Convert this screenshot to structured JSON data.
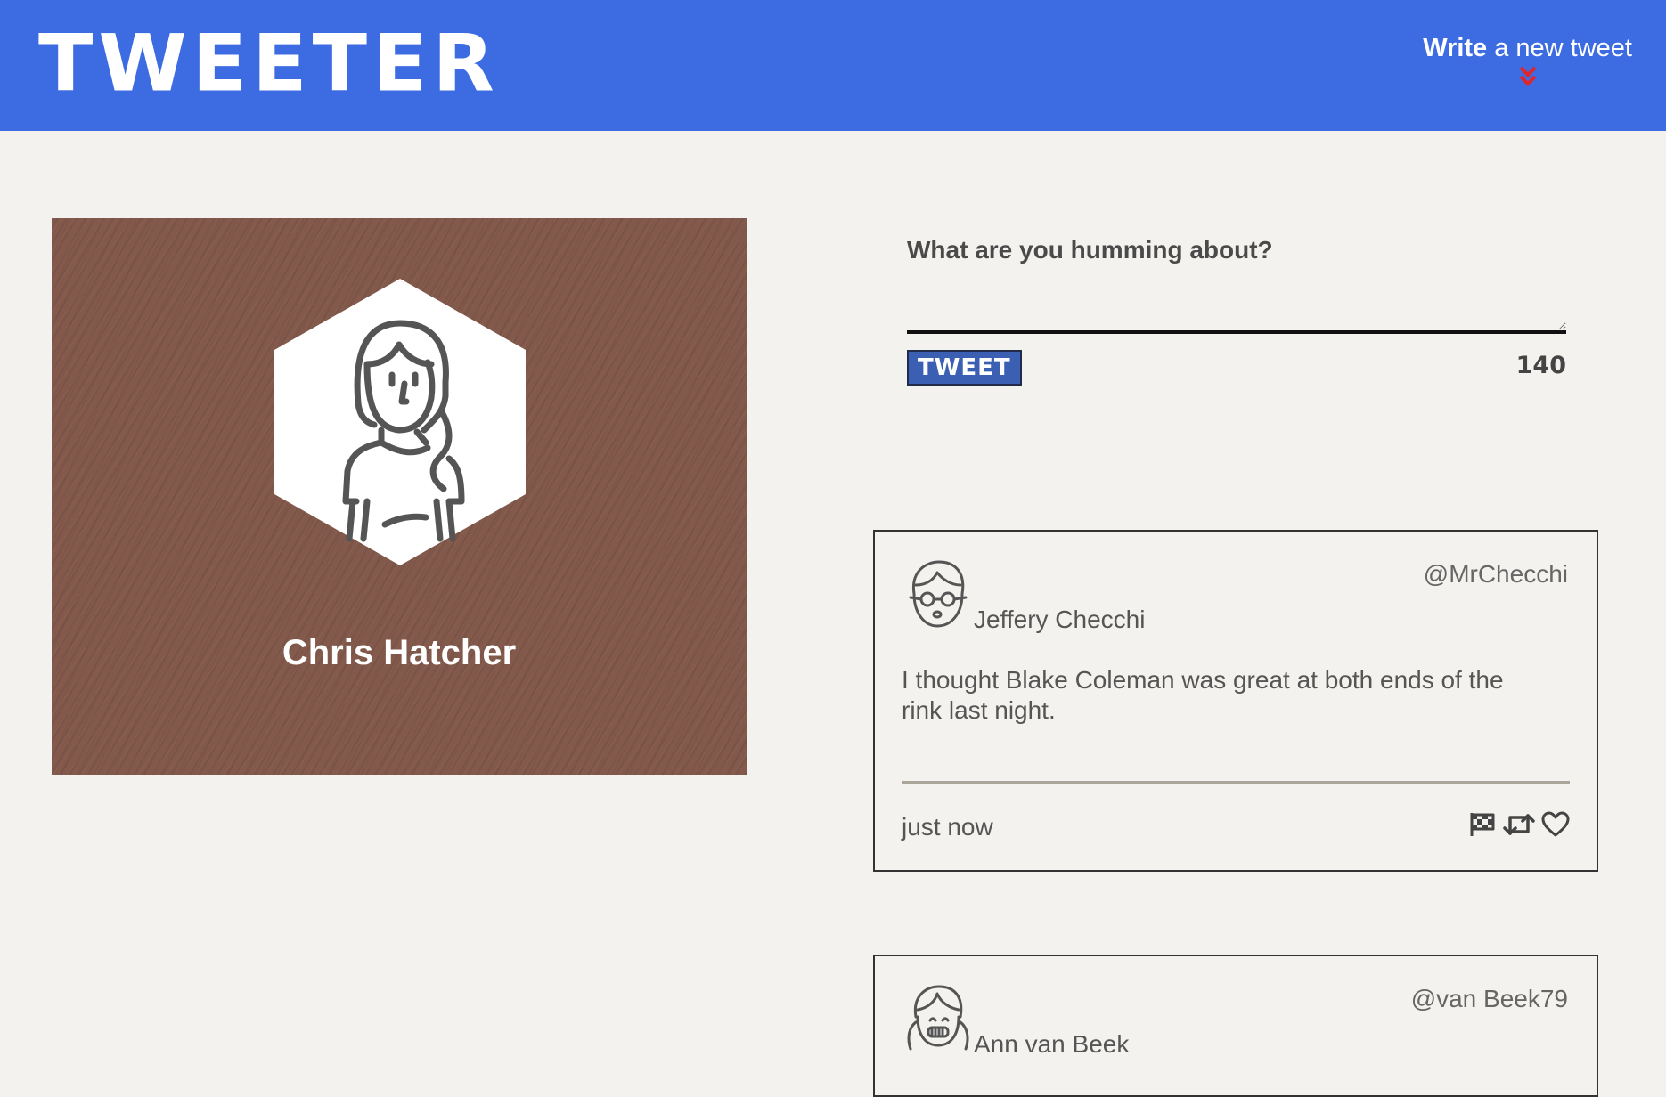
{
  "header": {
    "logo": "TWEETER",
    "compose_bold": "Write",
    "compose_rest": " a new tweet",
    "chevron_color": "#e0262a",
    "background": "#3d6be2"
  },
  "profile": {
    "name": "Chris Hatcher",
    "background": "#82594b"
  },
  "composer": {
    "label": "What are you humming about?",
    "value": "",
    "button_label": "TWEET",
    "counter": "140"
  },
  "tweets": [
    {
      "name": "Jeffery Checchi",
      "handle": "@MrChecchi",
      "text": "I thought Blake Coleman was great at both ends of the rink last night.",
      "time": "just now",
      "avatar_icon": "boy-glasses-avatar-icon"
    },
    {
      "name": "Ann van Beek",
      "handle": "@van Beek79",
      "avatar_icon": "girl-pigtails-avatar-icon"
    }
  ],
  "icons": {
    "flag": "flag-icon",
    "retweet": "retweet-icon",
    "like": "heart-icon"
  }
}
